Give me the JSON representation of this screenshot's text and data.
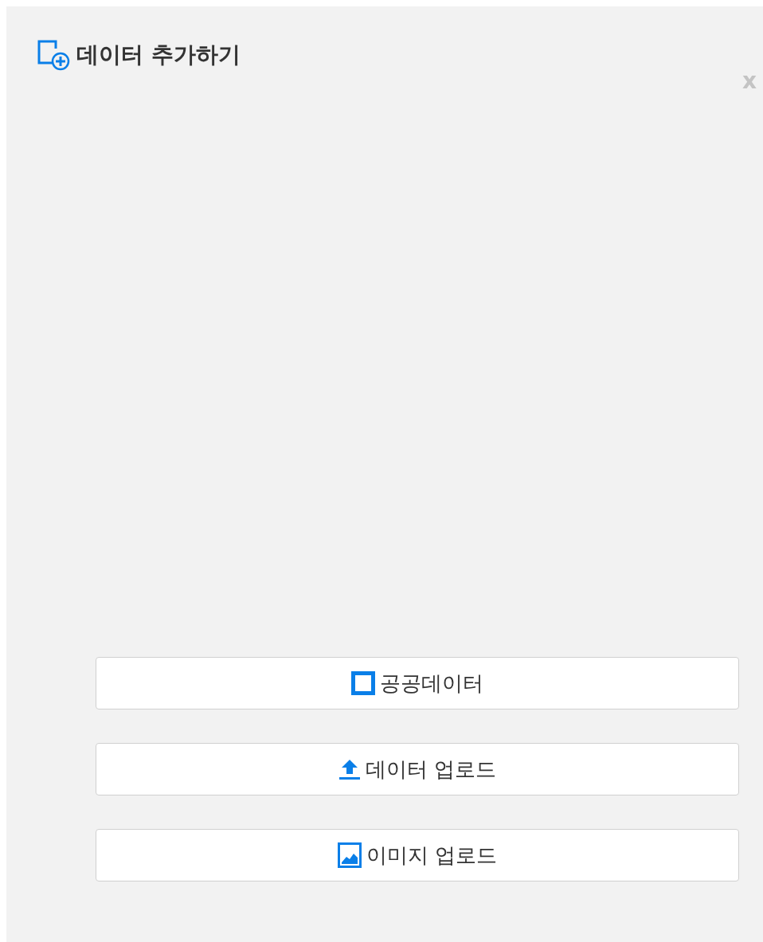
{
  "dialog": {
    "title": "데이터 추가하기",
    "close": "x"
  },
  "buttons": [
    {
      "label": "공공데이터",
      "kind": "square"
    },
    {
      "label": "데이터 업로드",
      "kind": "upload"
    },
    {
      "label": "이미지 업로드",
      "kind": "image"
    }
  ]
}
